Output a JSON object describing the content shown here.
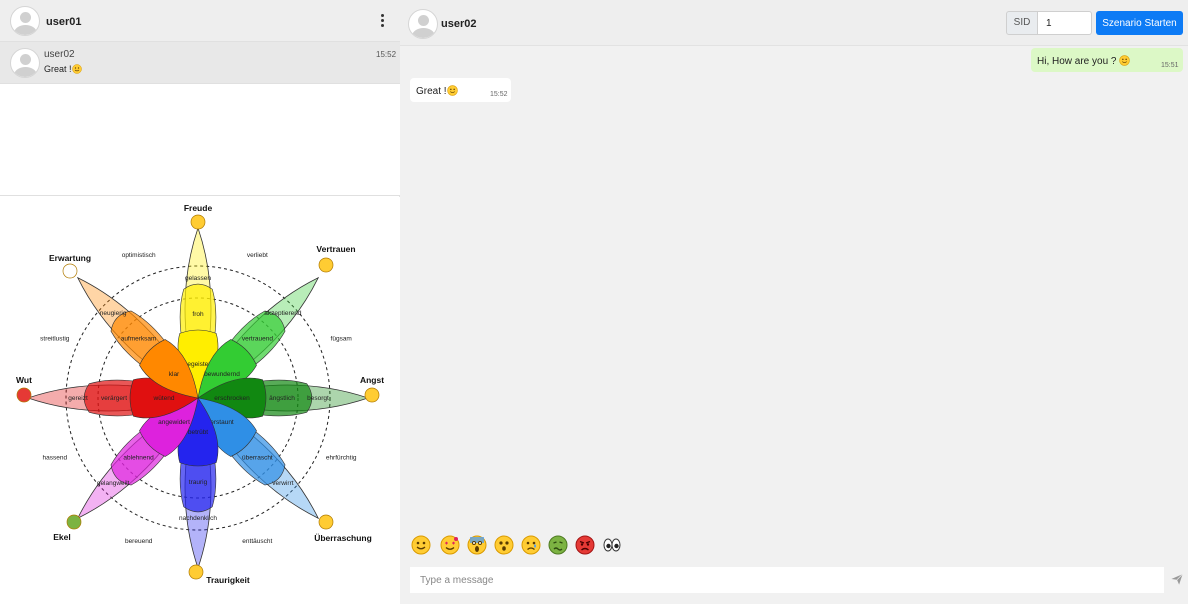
{
  "left_header": {
    "username": "user01",
    "menu_icon": "more-vertical-icon"
  },
  "contact": {
    "name": "user02",
    "last_message": "Great !",
    "time": "15:52"
  },
  "wheel": {
    "main_emotions": [
      "Freude",
      "Vertrauen",
      "Angst",
      "Überraschung",
      "Traurigkeit",
      "Ekel",
      "Wut",
      "Erwartung"
    ],
    "outer_words": [
      "verliebt",
      "fügsam",
      "ehrfürchtig",
      "enttäuscht",
      "bereuend",
      "hassend",
      "streitlustig",
      "optimistisch"
    ],
    "petals": [
      {
        "emotion": "Freude",
        "color": "#ffee00",
        "inner": "begeistert",
        "middle": "froh",
        "outer": "gelassen"
      },
      {
        "emotion": "Vertrauen",
        "color": "#33cc33",
        "inner": "bewundernd",
        "middle": "vertrauend",
        "outer": "akzeptierend"
      },
      {
        "emotion": "Angst",
        "color": "#118811",
        "inner": "erschrocken",
        "middle": "ängstlich",
        "outer": "besorgt"
      },
      {
        "emotion": "Überraschung",
        "color": "#2f8fe6",
        "inner": "erstaunt",
        "middle": "überrascht",
        "outer": "verwirrt"
      },
      {
        "emotion": "Traurigkeit",
        "color": "#2424ee",
        "inner": "betrübt",
        "middle": "traurig",
        "outer": "nachdenklich"
      },
      {
        "emotion": "Ekel",
        "color": "#dd22dd",
        "inner": "angewidert",
        "middle": "ablehnend",
        "outer": "gelangweilt"
      },
      {
        "emotion": "Wut",
        "color": "#e01010",
        "inner": "wütend",
        "middle": "verärgert",
        "outer": "gereizt"
      },
      {
        "emotion": "Erwartung",
        "color": "#ff8800",
        "inner": "klar",
        "middle": "aufmerksam",
        "outer": "neugierig"
      }
    ]
  },
  "chat_header": {
    "username": "user02",
    "sid_label": "SID",
    "sid_value": "1",
    "start_button": "Szenario Starten"
  },
  "messages": [
    {
      "direction": "out",
      "text": "Hi, How are you ?",
      "time": "15:51"
    },
    {
      "direction": "in",
      "text": "Great !",
      "time": "15:52"
    }
  ],
  "emoji_bar": [
    "smiling-face",
    "face-with-hearts",
    "screaming-face",
    "astonished-face",
    "sad-face",
    "nauseated-face",
    "angry-face",
    "eyes"
  ],
  "composer": {
    "placeholder": "Type a message",
    "send_icon": "send-icon"
  }
}
